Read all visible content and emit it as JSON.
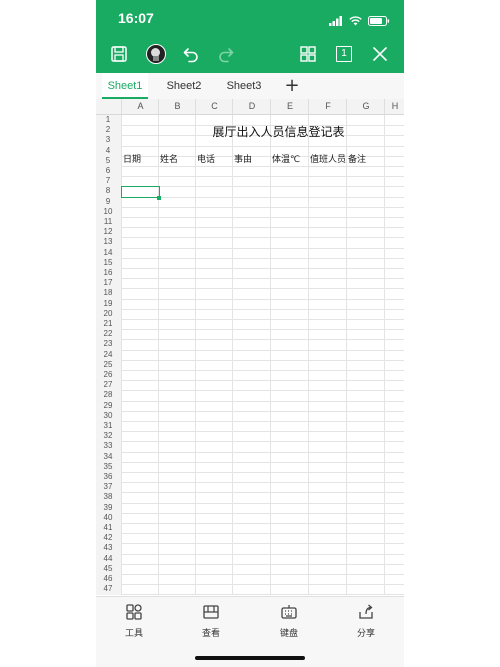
{
  "status": {
    "time": "16:07"
  },
  "tabs": [
    {
      "label": "Sheet1"
    },
    {
      "label": "Sheet2"
    },
    {
      "label": "Sheet3"
    }
  ],
  "toolbar": {
    "page_count": "1"
  },
  "columns": [
    "A",
    "B",
    "C",
    "D",
    "E",
    "F",
    "G",
    "H"
  ],
  "rows": [
    "1",
    "2",
    "3",
    "4",
    "5",
    "6",
    "7",
    "8",
    "9",
    "10",
    "11",
    "12",
    "13",
    "14",
    "15",
    "16",
    "17",
    "18",
    "19",
    "20",
    "21",
    "22",
    "23",
    "24",
    "25",
    "26",
    "27",
    "28",
    "29",
    "30",
    "31",
    "32",
    "33",
    "34",
    "35",
    "36",
    "37",
    "38",
    "39",
    "40",
    "41",
    "42",
    "43",
    "44",
    "45",
    "46",
    "47"
  ],
  "sheet": {
    "title": "展厅出入人员信息登记表",
    "headers": [
      "日期",
      "姓名",
      "电话",
      "事由",
      "体温℃",
      "值班人员",
      "备注"
    ]
  },
  "bottom": {
    "tools": "工具",
    "view": "查看",
    "keyboard": "键盘",
    "share": "分享"
  },
  "colors": {
    "accent": "#1aab63"
  }
}
